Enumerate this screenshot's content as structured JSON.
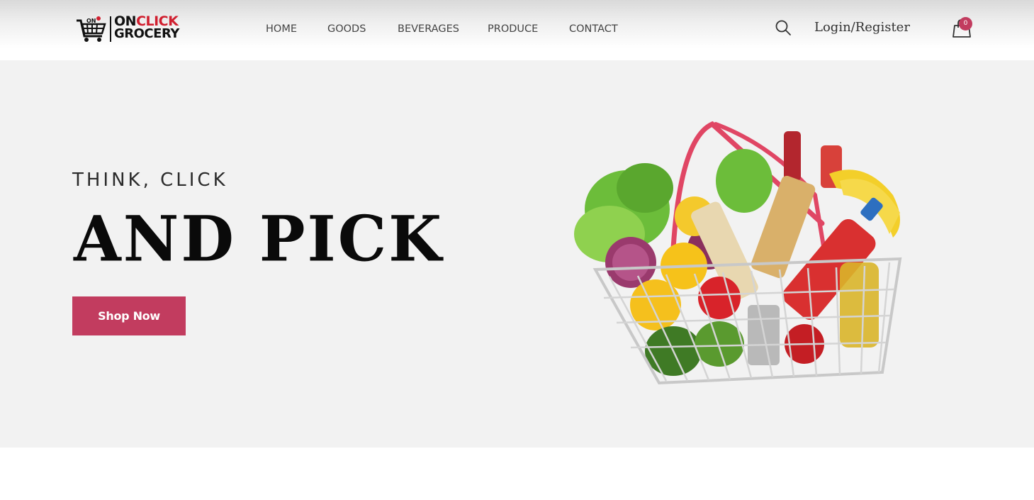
{
  "brand": {
    "logo_line1_on": "ON",
    "logo_line1_click": "CLICK",
    "logo_line2": "GROCERY",
    "logo_cart_mark": "ON",
    "accent_red": "#d01f2f"
  },
  "nav": {
    "items": [
      {
        "label": "HOME"
      },
      {
        "label": "GOODS"
      },
      {
        "label": "BEVERAGES"
      },
      {
        "label": "PRODUCE"
      },
      {
        "label": "CONTACT"
      }
    ]
  },
  "header_actions": {
    "search_icon": "search-icon",
    "login_label": "Login/Register",
    "cart_icon": "shopping-bag-icon",
    "cart_count": "0"
  },
  "hero": {
    "subtitle": "THINK, CLICK",
    "title": "AND PICK",
    "cta_label": "Shop Now",
    "image": "grocery-basket-image",
    "accent_color": "#c23c5f",
    "background": "#f2f2f2"
  }
}
